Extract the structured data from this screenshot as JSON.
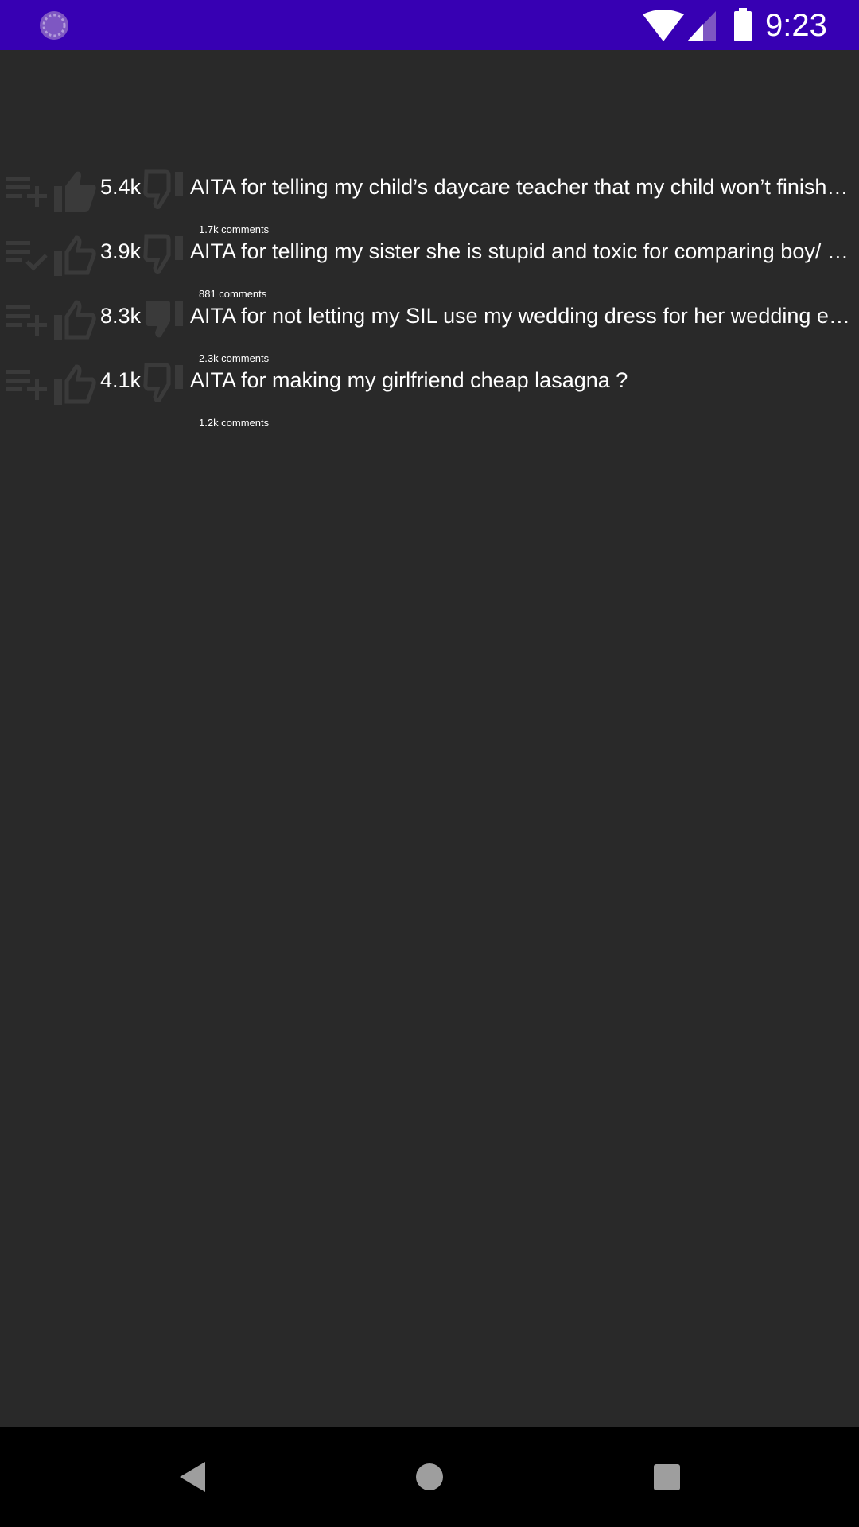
{
  "status_bar": {
    "time": "9:23",
    "app_icon": "loading-spinner-icon",
    "icons": [
      "wifi-icon",
      "cellular-signal-icon",
      "battery-icon"
    ],
    "bar_color": "#3700b3"
  },
  "posts": [
    {
      "score": "5.4k",
      "title": "AITA for telling my child’s daycare teacher that my child won’t finish cle…",
      "comments": "1.7k comments",
      "list_icon": "playlist-add-icon",
      "upvote_icon": "thumb-up-filled-icon",
      "downvote_icon": "thumb-down-outline-icon"
    },
    {
      "score": "3.9k",
      "title": "AITA for telling my sister she is stupid and toxic for comparing boy/ girl…",
      "comments": "881 comments",
      "list_icon": "playlist-add-check-icon",
      "upvote_icon": "thumb-up-outline-icon",
      "downvote_icon": "thumb-down-outline-icon"
    },
    {
      "score": "8.3k",
      "title": "AITA for not letting my SIL use my wedding dress for her wedding even…",
      "comments": "2.3k comments",
      "list_icon": "playlist-add-icon",
      "upvote_icon": "thumb-up-outline-icon",
      "downvote_icon": "thumb-down-filled-icon"
    },
    {
      "score": "4.1k",
      "title": "AITA for making my girlfriend cheap lasagna ?",
      "comments": "1.2k comments",
      "list_icon": "playlist-add-icon",
      "upvote_icon": "thumb-up-outline-icon",
      "downvote_icon": "thumb-down-outline-icon"
    }
  ],
  "nav_bar": {
    "icons": [
      "back-icon",
      "home-icon",
      "recents-icon"
    ]
  },
  "colors": {
    "background": "#292929",
    "text": "#ffffff",
    "faded_icon": "#3a3a3a",
    "nav_bar": "#000000",
    "nav_icon": "#9e9e9e"
  }
}
